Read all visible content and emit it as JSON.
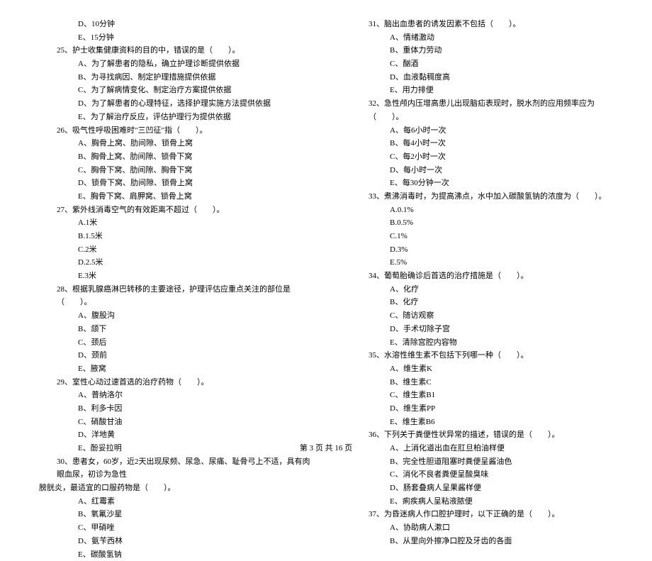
{
  "left_col": {
    "pre_opts": [
      "D、10分钟",
      "E、15分钟"
    ],
    "q25": {
      "stem": "25、护士收集健康资料的目的中，错误的是（　　）。",
      "opts": [
        "A、为了解患者的隐私，确立护理诊断提供依据",
        "B、为寻找病因、制定护理措施提供依据",
        "C、为了解病情变化、制定治疗方案提供依据",
        "D、为了解患者的心理特征，选择护理实施方法提供依据",
        "E、为了解治疗反应，评估护理行为提供依据"
      ]
    },
    "q26": {
      "stem": "26、吸气性呼吸困难时\"三凹征\"指（　　）。",
      "opts": [
        "A、胸骨上窝、肋间隙、锁骨上窝",
        "B、胸骨上窝、肋间隙、锁骨下窝",
        "C、胸骨下窝、肋间隙、胸骨下窝",
        "D、锁骨下窝、肋间隙、锁骨上窝",
        "E、胸骨下窝、肩胛窝、锁骨上窝"
      ]
    },
    "q27": {
      "stem": "27、紫外线消毒空气的有效距离不超过（　　）。",
      "opts": [
        "A.1米",
        "B.1.5米",
        "C.2米",
        "D.2.5米",
        "E.3米"
      ]
    },
    "q28": {
      "stem": "28、根据乳腺癌淋巴转移的主要途径，护理评估应重点关注的部位是（　　）。",
      "opts": [
        "A、腹股沟",
        "B、颌下",
        "C、颈后",
        "D、颈前",
        "E、腋窝"
      ]
    },
    "q29": {
      "stem": "29、室性心动过速首选的治疗药物（　　）。",
      "opts": [
        "A、普纳洛尔",
        "B、利多卡因",
        "C、硝酸甘油",
        "D、洋地黄",
        "E、酚妥拉明"
      ]
    },
    "q30": {
      "stem": "30、患者女，60岁，近2天出现尿频、尿急、尿痛、耻骨弓上不适，具有肉眼血尿，初诊为急性",
      "stem2": "膀胱炎，最适宜的口服药物是（　　）。",
      "opts": [
        "A、红霉素",
        "B、氧氟沙星",
        "C、甲硝唑",
        "D、氨苄西林",
        "E、碳酸氢钠"
      ]
    }
  },
  "right_col": {
    "q31": {
      "stem": "31、脑出血患者的诱发因素不包括（　　）。",
      "opts": [
        "A、情绪激动",
        "B、重体力劳动",
        "C、酗酒",
        "D、血液黏稠度高",
        "E、用力排便"
      ]
    },
    "q32": {
      "stem": "32、急性颅内压增高患儿出现脑疝表现时，脱水剂的应用频率应为（　　）。",
      "opts": [
        "A、每6小时一次",
        "B、每4小时一次",
        "C、每2小时一次",
        "D、每小时一次",
        "E、每30分钟一次"
      ]
    },
    "q33": {
      "stem": "33、煮沸消毒时，为提高沸点，水中加入碳酸氢钠的浓度为（　　）。",
      "opts": [
        "A.0.1%",
        "B.0.5%",
        "C.1%",
        "D.3%",
        "E.5%"
      ]
    },
    "q34": {
      "stem": "34、葡萄胎确诊后首选的治疗措施是（　　）。",
      "opts": [
        "A、化疗",
        "B、化疗",
        "C、随访观察",
        "D、手术切除子宫",
        "E、清除宫腔内容物"
      ]
    },
    "q35": {
      "stem": "35、水溶性维生素不包括下列哪一种（　　）。",
      "opts": [
        "A、维生素K",
        "B、维生素C",
        "C、维生素B1",
        "D、维生素PP",
        "E、维生素B6"
      ]
    },
    "q36": {
      "stem": "36、下列关于粪便性状异常的描述，错误的是（　　）。",
      "opts": [
        "A、上消化道出血在肛旦柏油样便",
        "B、完全性胆道阻塞时粪便呈酱油色",
        "C、消化不良者粪便呈酸臭味",
        "D、肠套叠病人呈果酱样便",
        "E、痢疾病人呈粘液脓便"
      ]
    },
    "q37": {
      "stem": "37、为昏迷病人作口腔护理时，以下正确的是（　　）。",
      "opts": [
        "A、协助病人漱口",
        "B、从里向外擦净口腔及牙齿的各面"
      ]
    }
  },
  "footer": "第 3 页 共 16 页"
}
